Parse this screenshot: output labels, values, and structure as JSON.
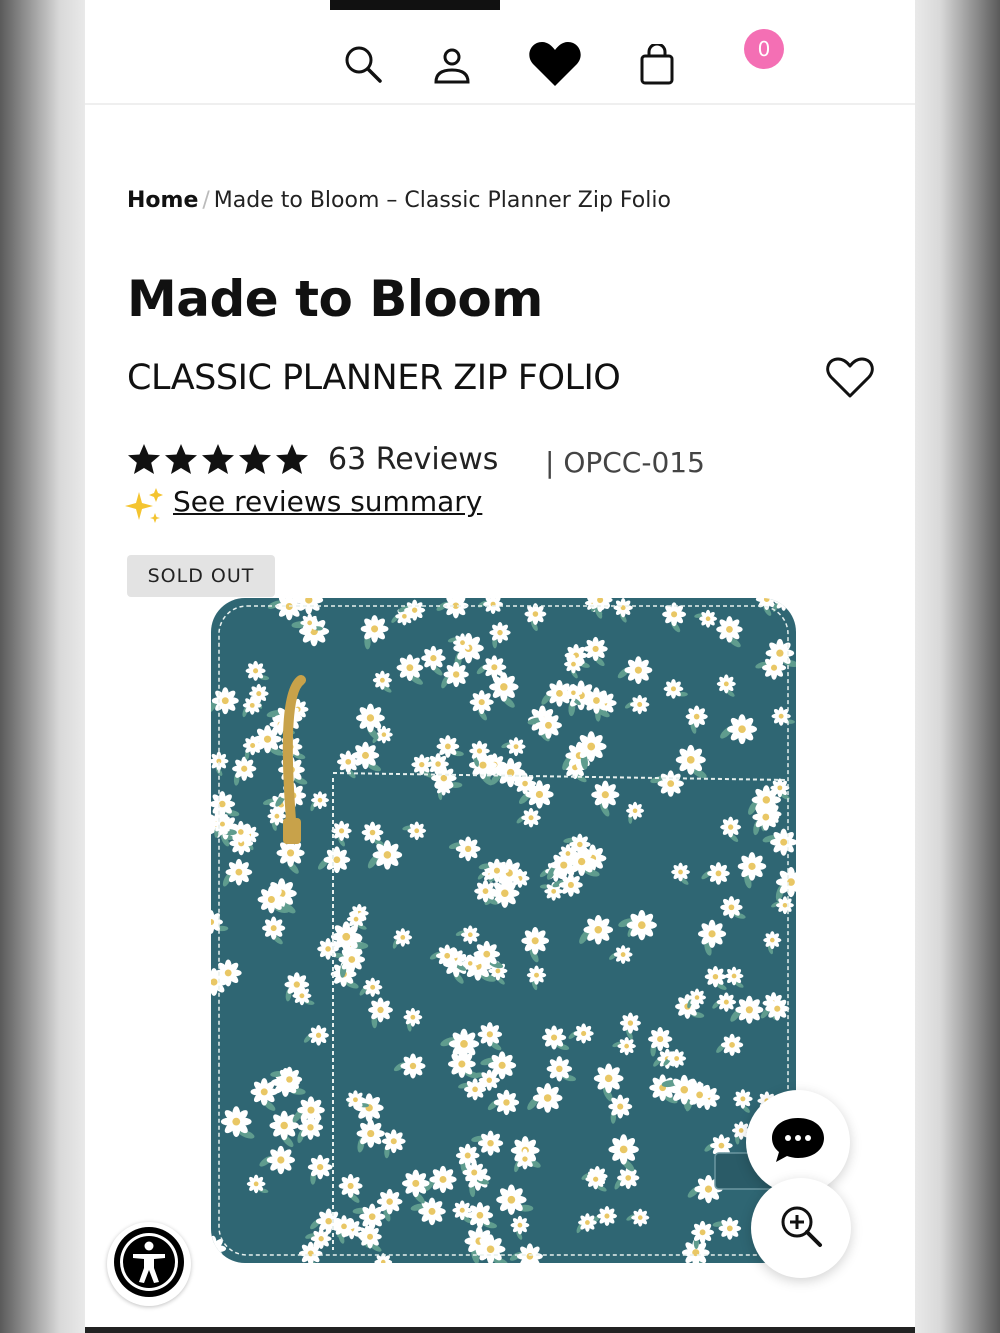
{
  "header": {
    "icons": [
      "search-icon",
      "account-icon",
      "wishlist-heart-icon",
      "cart-icon"
    ],
    "cart_count": "0"
  },
  "breadcrumb": {
    "home": "Home",
    "separator": "/",
    "current": "Made to Bloom – Classic Planner Zip Folio"
  },
  "product": {
    "title": "Made to Bloom",
    "subtitle": "CLASSIC PLANNER ZIP FOLIO",
    "rating": 5,
    "reviews_label": "63 Reviews",
    "sku": "| OPCC-015",
    "summary_link": "See reviews summary",
    "status_badge": "SOLD OUT",
    "image_colors": {
      "fabric": "#2f6673",
      "flower": "#ffffff",
      "flower_center": "#e9c765",
      "zipper": "#c8a24a"
    }
  },
  "floating": {
    "chat_icon": "chat-bubble-icon",
    "zoom_icon": "zoom-in-icon",
    "accessibility_icon": "accessibility-icon"
  },
  "colors": {
    "accent": "#f46fb4",
    "text": "#111111",
    "badge_bg": "#e3e3e3",
    "sparkle": "#f4c430"
  }
}
